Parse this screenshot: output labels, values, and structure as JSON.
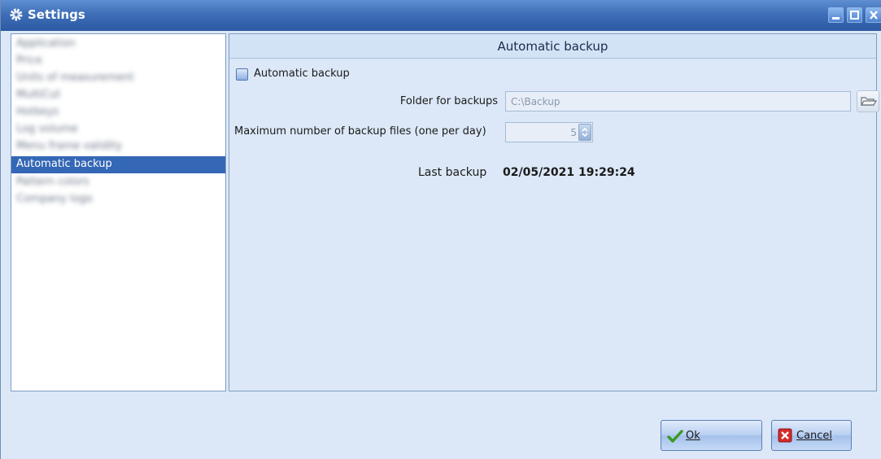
{
  "window": {
    "title": "Settings",
    "icon": "gear-icon"
  },
  "controls": {
    "minimize": "minimize-icon",
    "maximize": "maximize-icon",
    "close": "close-icon"
  },
  "nav": {
    "items": [
      {
        "label": "Application",
        "blurred": true
      },
      {
        "label": "Price",
        "blurred": true
      },
      {
        "label": "Units of measurement",
        "blurred": true
      },
      {
        "label": "MultiCut",
        "blurred": true
      },
      {
        "label": "Hotkeys",
        "blurred": true
      },
      {
        "label": "Log volume",
        "blurred": true
      },
      {
        "label": "Menu frame validity",
        "blurred": true
      },
      {
        "label": "Automatic backup",
        "blurred": false,
        "selected": true
      },
      {
        "label": "Pattern colors",
        "blurred": true
      },
      {
        "label": "Company logo",
        "blurred": true
      }
    ]
  },
  "panel": {
    "header": "Automatic backup",
    "enable": {
      "label": "Automatic backup",
      "checked": false
    },
    "folder": {
      "label": "Folder for backups",
      "value": "C:\\Backup"
    },
    "max_files": {
      "label": "Maximum number of backup files (one per day)",
      "value": "5"
    },
    "last_backup": {
      "label": "Last backup",
      "value": "02/05/2021 19:29:24"
    }
  },
  "buttons": {
    "ok": "Ok",
    "cancel": "Cancel"
  },
  "colors": {
    "title_bar": "#3e6fb8",
    "selection": "#3467b6",
    "panel_bg": "#dce8f7"
  }
}
